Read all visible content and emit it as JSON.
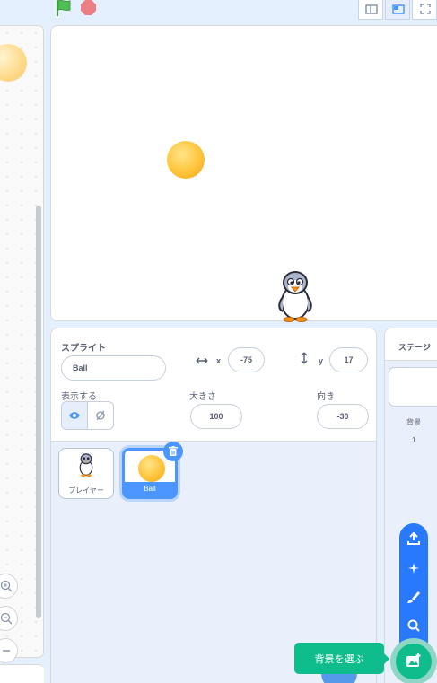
{
  "sprite_info": {
    "title": "スプライト",
    "name_value": "Ball",
    "x_label": "x",
    "x_value": "-75",
    "y_label": "y",
    "y_value": "17",
    "show_label": "表示する",
    "size_label": "大きさ",
    "size_value": "100",
    "direction_label": "向き",
    "direction_value": "-30"
  },
  "sprites": [
    {
      "name": "プレイヤー",
      "selected": false
    },
    {
      "name": "Ball",
      "selected": true
    }
  ],
  "stage_pane": {
    "title": "ステージ",
    "backdrop_label": "背景",
    "backdrop_count": "1"
  },
  "tooltip": {
    "choose_backdrop": "背景を選ぶ"
  },
  "colors": {
    "accent_blue": "#4c97ff",
    "green": "#0fbd8c",
    "menu_blue": "#2979ff"
  },
  "icons": [
    "green-flag-icon",
    "stop-icon",
    "small-stage-icon",
    "normal-stage-icon",
    "fullscreen-icon",
    "zoom-in-icon",
    "zoom-out-icon",
    "eye-icon",
    "hidden-icon",
    "trash-icon",
    "upload-icon",
    "surprise-icon",
    "paint-icon",
    "search-icon",
    "backdrop-icon"
  ]
}
